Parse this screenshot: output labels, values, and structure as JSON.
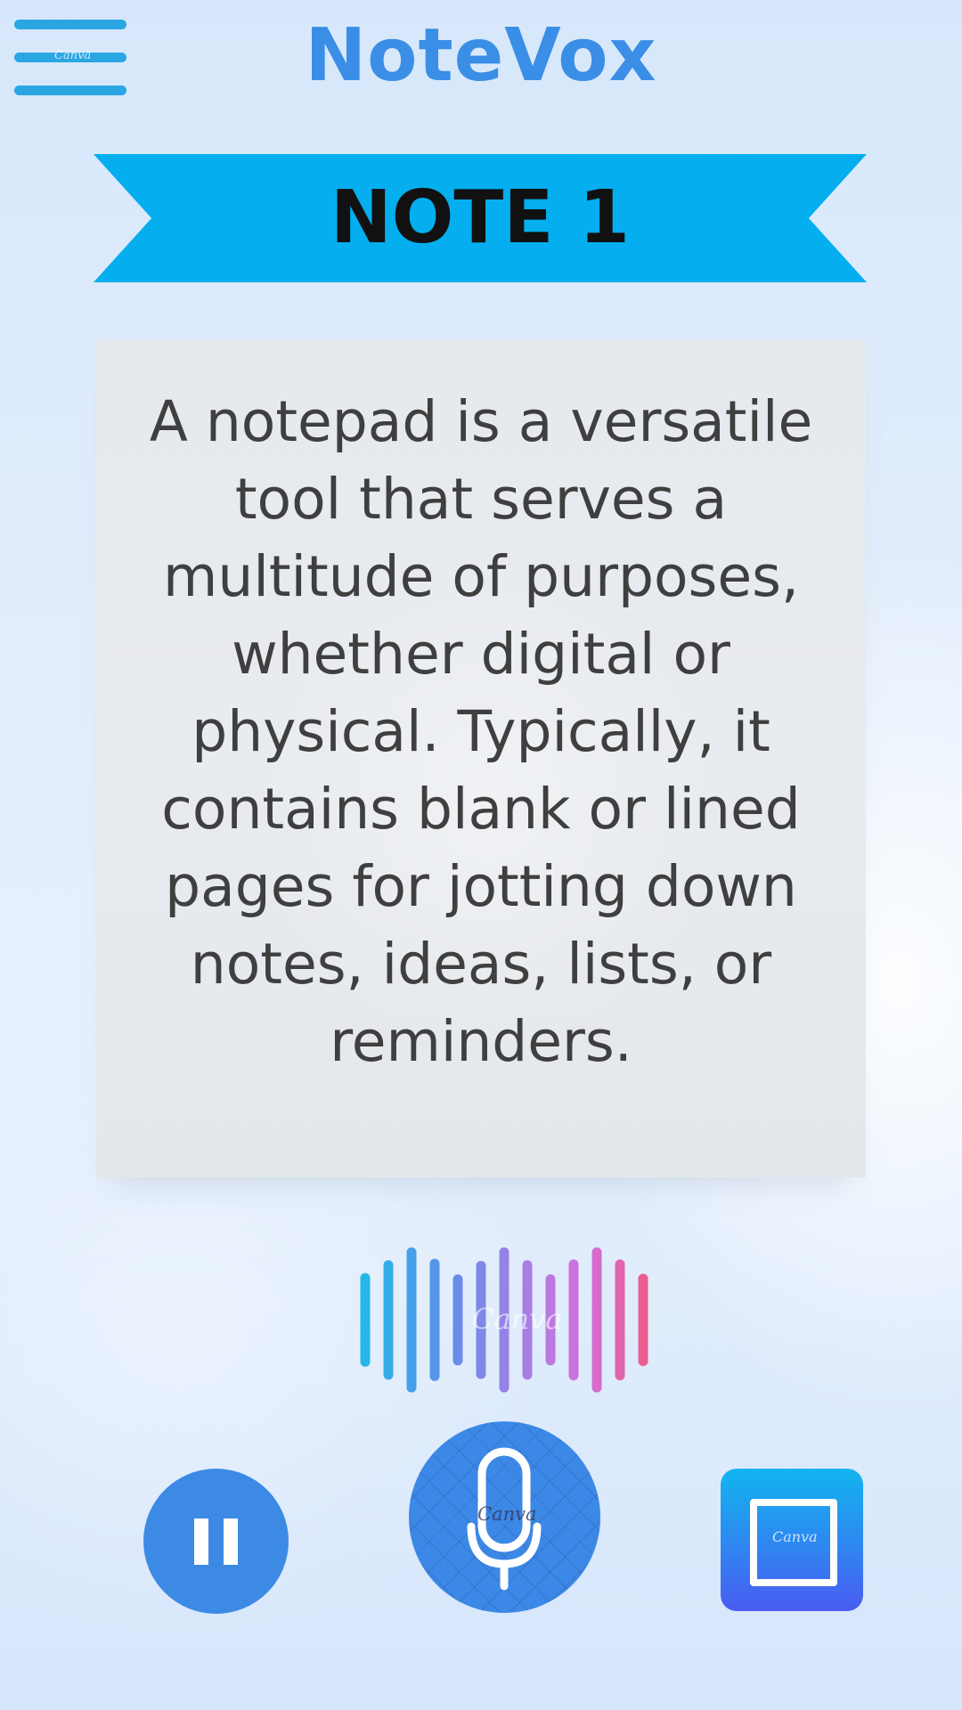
{
  "header": {
    "app_title": "NoteVox",
    "menu_icon": "hamburger-menu-icon",
    "menu_watermark": "Canva"
  },
  "banner": {
    "note_title": "NOTE 1"
  },
  "note": {
    "body_text": "A notepad is a versatile tool that serves a multitude of purposes, whether digital or physical. Typically, it contains blank or lined pages for jotting down notes, ideas, lists, or reminders."
  },
  "waveform": {
    "icon": "audio-waveform-icon",
    "watermark": "Canva",
    "colors": [
      "#22b9ea",
      "#5f8fe8",
      "#a57fe6",
      "#d36fd9",
      "#ec5a86"
    ],
    "levels": [
      0.62,
      0.81,
      1.0,
      0.83,
      0.6,
      0.8,
      1.0,
      0.81,
      0.6,
      0.82,
      1.0,
      0.82,
      0.61
    ]
  },
  "controls": {
    "pause": {
      "icon": "pause-icon",
      "color": "#3d8ae5"
    },
    "record": {
      "icon": "microphone-icon",
      "color": "#3c88e6",
      "watermark": "Canva"
    },
    "stop": {
      "icon": "stop-square-icon",
      "watermark": "Canva"
    }
  },
  "colors": {
    "accent": "#3a8ee6",
    "banner": "#04aeef",
    "menu": "#2aa6e3",
    "text": "#3f3f3f"
  }
}
